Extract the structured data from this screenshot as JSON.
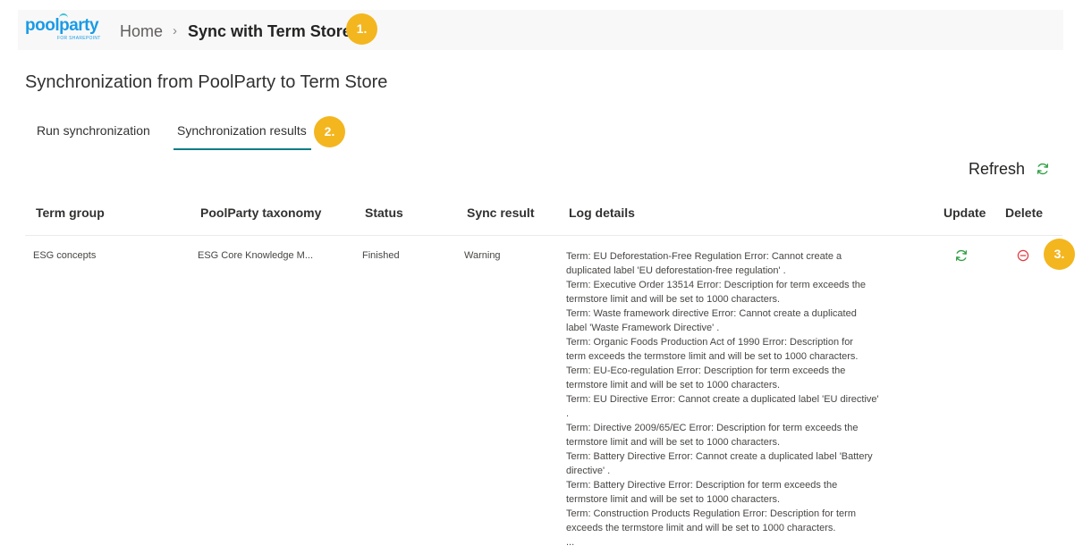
{
  "header": {
    "logo_main": "poolparty",
    "logo_sub": "FOR SHAREPOINT",
    "breadcrumb_home": "Home",
    "breadcrumb_separator": "›",
    "breadcrumb_current": "Sync with Term Store"
  },
  "badges": [
    "1.",
    "2.",
    "3."
  ],
  "page_title": "Synchronization from PoolParty to Term Store",
  "tabs": [
    {
      "label": "Run synchronization",
      "active": false
    },
    {
      "label": "Synchronization results",
      "active": true
    }
  ],
  "toolbar": {
    "refresh_label": "Refresh"
  },
  "table": {
    "columns": [
      "Term group",
      "PoolParty taxonomy",
      "Status",
      "Sync result",
      "Log details",
      "Update",
      "Delete"
    ],
    "rows": [
      {
        "term_group": "ESG concepts",
        "taxonomy": "ESG Core Knowledge M...",
        "status": "Finished",
        "sync_result": "Warning",
        "log_lines": [
          "Term: EU Deforestation-Free Regulation Error: Cannot create a\nduplicated label 'EU deforestation-free regulation' .",
          "Term: Executive Order 13514 Error: Description for term exceeds the\ntermstore limit and will be set to 1000 characters.",
          "Term: Waste framework directive Error: Cannot create a duplicated\nlabel 'Waste Framework Directive' .",
          "Term: Organic Foods Production Act of 1990 Error: Description for\nterm exceeds the termstore limit and will be set to 1000 characters.",
          "Term: EU-Eco-regulation Error: Description for term exceeds the\ntermstore limit and will be set to 1000 characters.",
          "Term: EU Directive Error: Cannot create a duplicated label 'EU directive'\n.",
          "Term: Directive 2009/65/EC Error: Description for term exceeds the\ntermstore limit and will be set to 1000 characters.",
          "Term: Battery Directive Error: Cannot create a duplicated label 'Battery\ndirective' .",
          "Term: Battery Directive Error: Description for term exceeds the\ntermstore limit and will be set to 1000 characters.",
          "Term: Construction Products Regulation Error: Description for term\nexceeds the termstore limit and will be set to 1000 characters.",
          "..."
        ]
      }
    ]
  },
  "colors": {
    "accent": "#0e7c86",
    "badge": "#f3b61f",
    "sync_icon": "#2e9e44",
    "delete_icon": "#e0393e",
    "logo": "#1a9be6"
  },
  "icons": {
    "refresh": "sync-icon",
    "update": "sync-icon",
    "delete": "minus-circle-icon"
  }
}
